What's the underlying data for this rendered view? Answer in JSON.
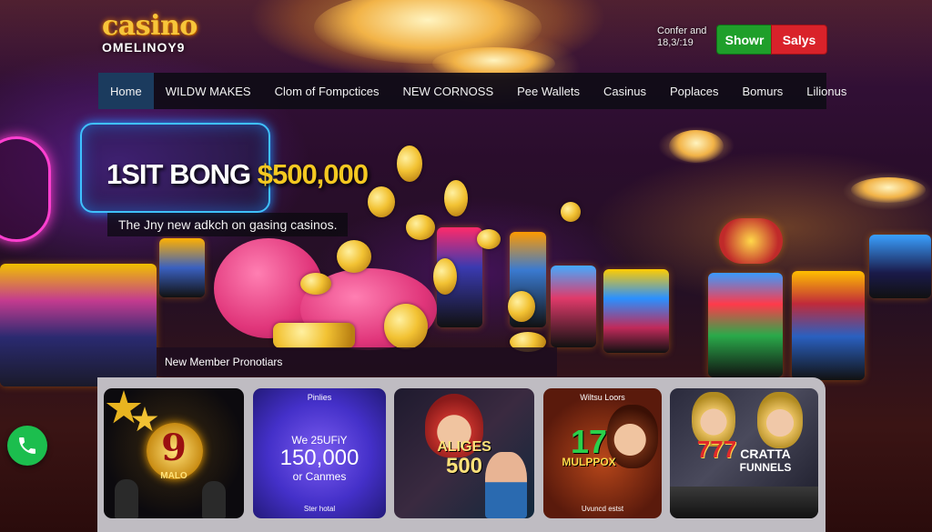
{
  "logo": {
    "line1": "casino",
    "line2": "OMELINOY9"
  },
  "header": {
    "text_line1": "Confer and",
    "text_line2": "18,3/:19",
    "show_label": "Showr",
    "sign_label": "Salys"
  },
  "nav": {
    "items": [
      "Home",
      "WILDW MAKES",
      "Clom of Fompctices",
      "NEW CORNOSS",
      "Pee Wallets",
      "Casinus",
      "Poplaces",
      "Bomurs",
      "Lilionus"
    ],
    "active": "Home"
  },
  "hero": {
    "title_white": "1SIT BONG",
    "title_gold": "$500,000",
    "subtitle": "The Jny new adkch on gasing casinos."
  },
  "promo": {
    "label": "New Member Pronotiars"
  },
  "cards": [
    {
      "big": "9",
      "small": "MALO"
    },
    {
      "top": "Pinlies",
      "line1": "We 25UFiY",
      "line2": "150,000",
      "line3": "or Canmes",
      "bottom": "Ster hotal"
    },
    {
      "line1": "ALIGES",
      "line2": "500"
    },
    {
      "top": "Wiltsu Loors",
      "big": "17",
      "mid": "MULPPOX",
      "bottom": "Uvuncd estst"
    },
    {
      "big": "777",
      "line1": "CRATTA",
      "line2": "FUNNELS"
    }
  ],
  "icons": {
    "whatsapp": "phone-icon"
  },
  "colors": {
    "show": "#1f9f2a",
    "sign": "#d9222a",
    "nav_active": "#1b3b5e",
    "gold": "#f4c821"
  }
}
